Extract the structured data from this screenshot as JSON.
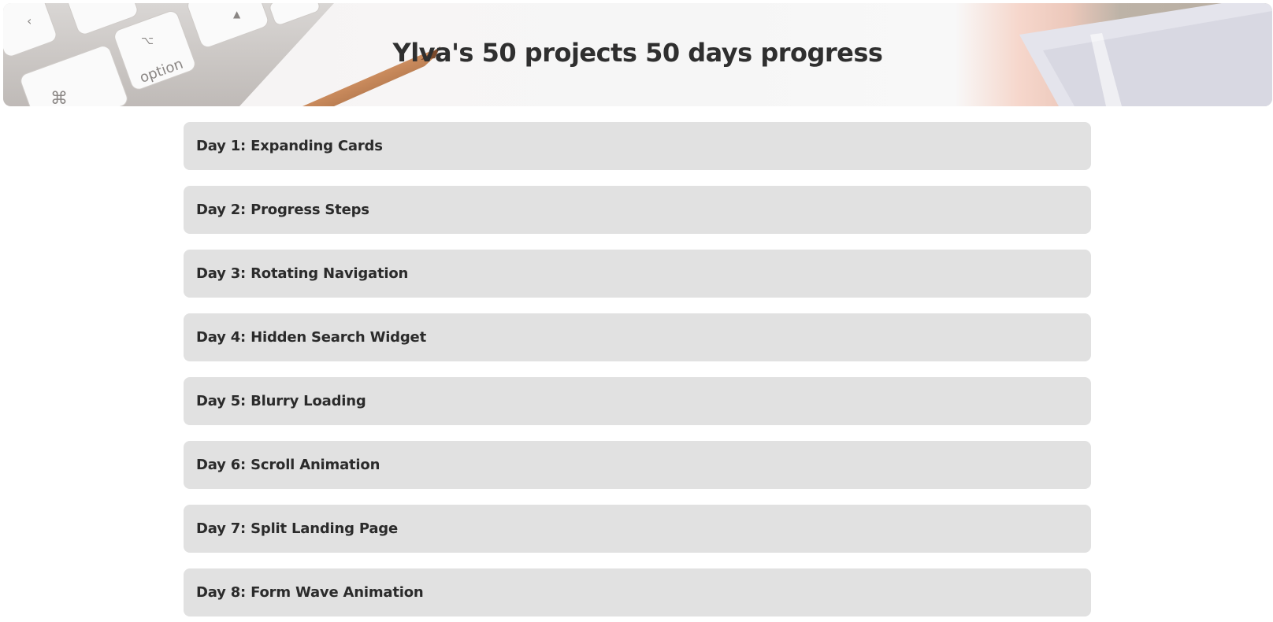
{
  "header": {
    "title": "Ylva's 50 projects 50 days progress",
    "keyboard_keys": [
      "option",
      "⌘"
    ]
  },
  "projects": [
    {
      "label": "Day 1: Expanding Cards"
    },
    {
      "label": "Day 2: Progress Steps"
    },
    {
      "label": "Day 3: Rotating Navigation"
    },
    {
      "label": "Day 4: Hidden Search Widget"
    },
    {
      "label": "Day 5: Blurry Loading"
    },
    {
      "label": "Day 6: Scroll Animation"
    },
    {
      "label": "Day 7: Split Landing Page"
    },
    {
      "label": "Day 8: Form Wave Animation"
    }
  ],
  "colors": {
    "item_background": "#e1e1e1",
    "text": "#2b2b2b",
    "page_background": "#ffffff"
  }
}
